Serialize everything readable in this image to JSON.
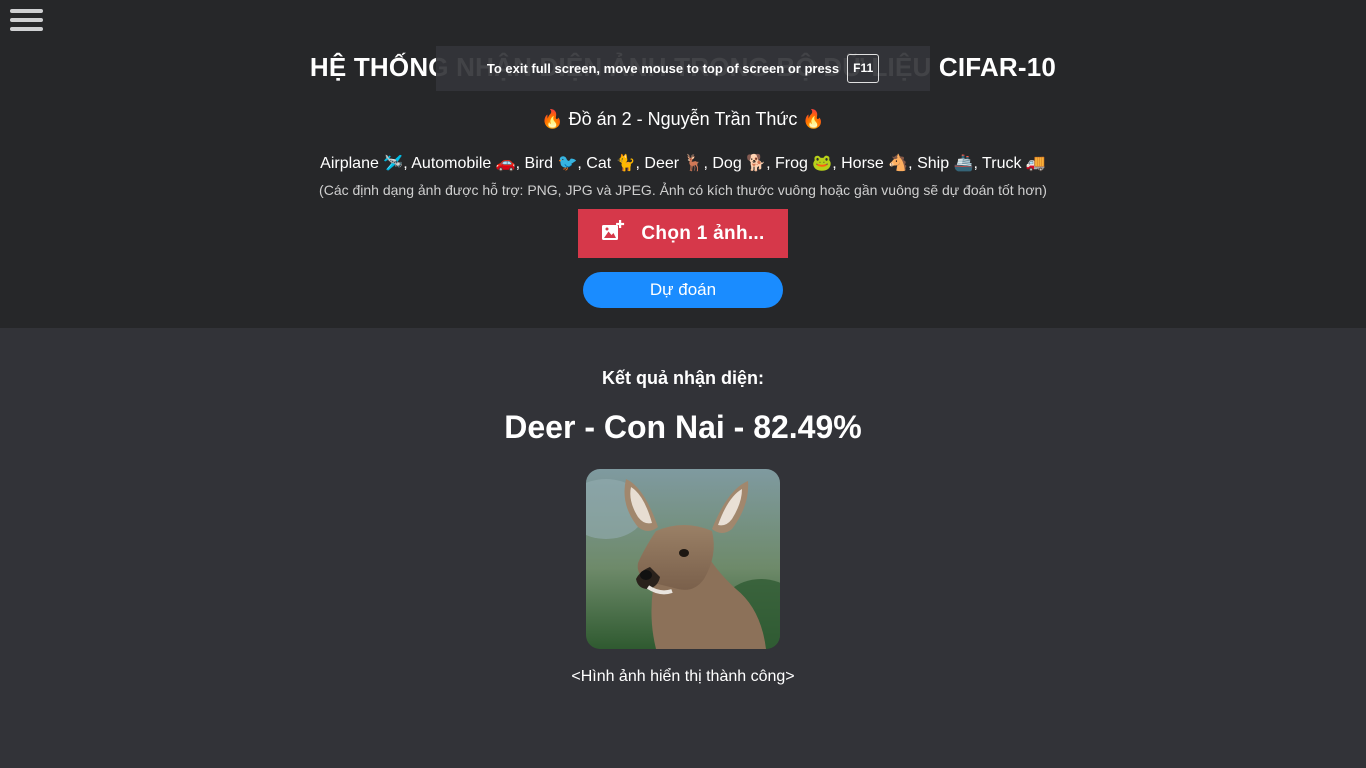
{
  "header": {
    "title": "HỆ THỐNG NHẬN DIỆN ẢNH TRONG BỘ DỮ LIỆU CIFAR-10",
    "subtitle": "🔥 Đồ án 2 - Nguyễn Trần Thức 🔥",
    "classes": "Airplane 🛩️, Automobile 🚗, Bird 🐦, Cat 🐈, Deer 🦌, Dog 🐕, Frog 🐸, Horse 🐴, Ship 🚢, Truck 🚚",
    "formats_note": "(Các định dạng ảnh được hỗ trợ: PNG, JPG và JPEG. Ảnh có kích thước vuông hoặc gần vuông sẽ dự đoán tốt hơn)"
  },
  "fullscreen_notice": {
    "message": "To exit full screen, move mouse to top of screen or press",
    "key": "F11"
  },
  "controls": {
    "choose_label": "Chọn 1 ảnh...",
    "predict_label": "Dự đoán"
  },
  "result": {
    "heading": "Kết quả nhận diện:",
    "value": "Deer - Con Nai - 82.49%",
    "caption": "<Hình ảnh hiển thị thành công>"
  },
  "colors": {
    "top_background": "#262729",
    "bottom_background": "#323338",
    "choose_button": "#d6384a",
    "predict_button": "#1a8cff"
  },
  "icons": {
    "menu": "hamburger-menu-icon",
    "choose": "add-image-icon"
  }
}
